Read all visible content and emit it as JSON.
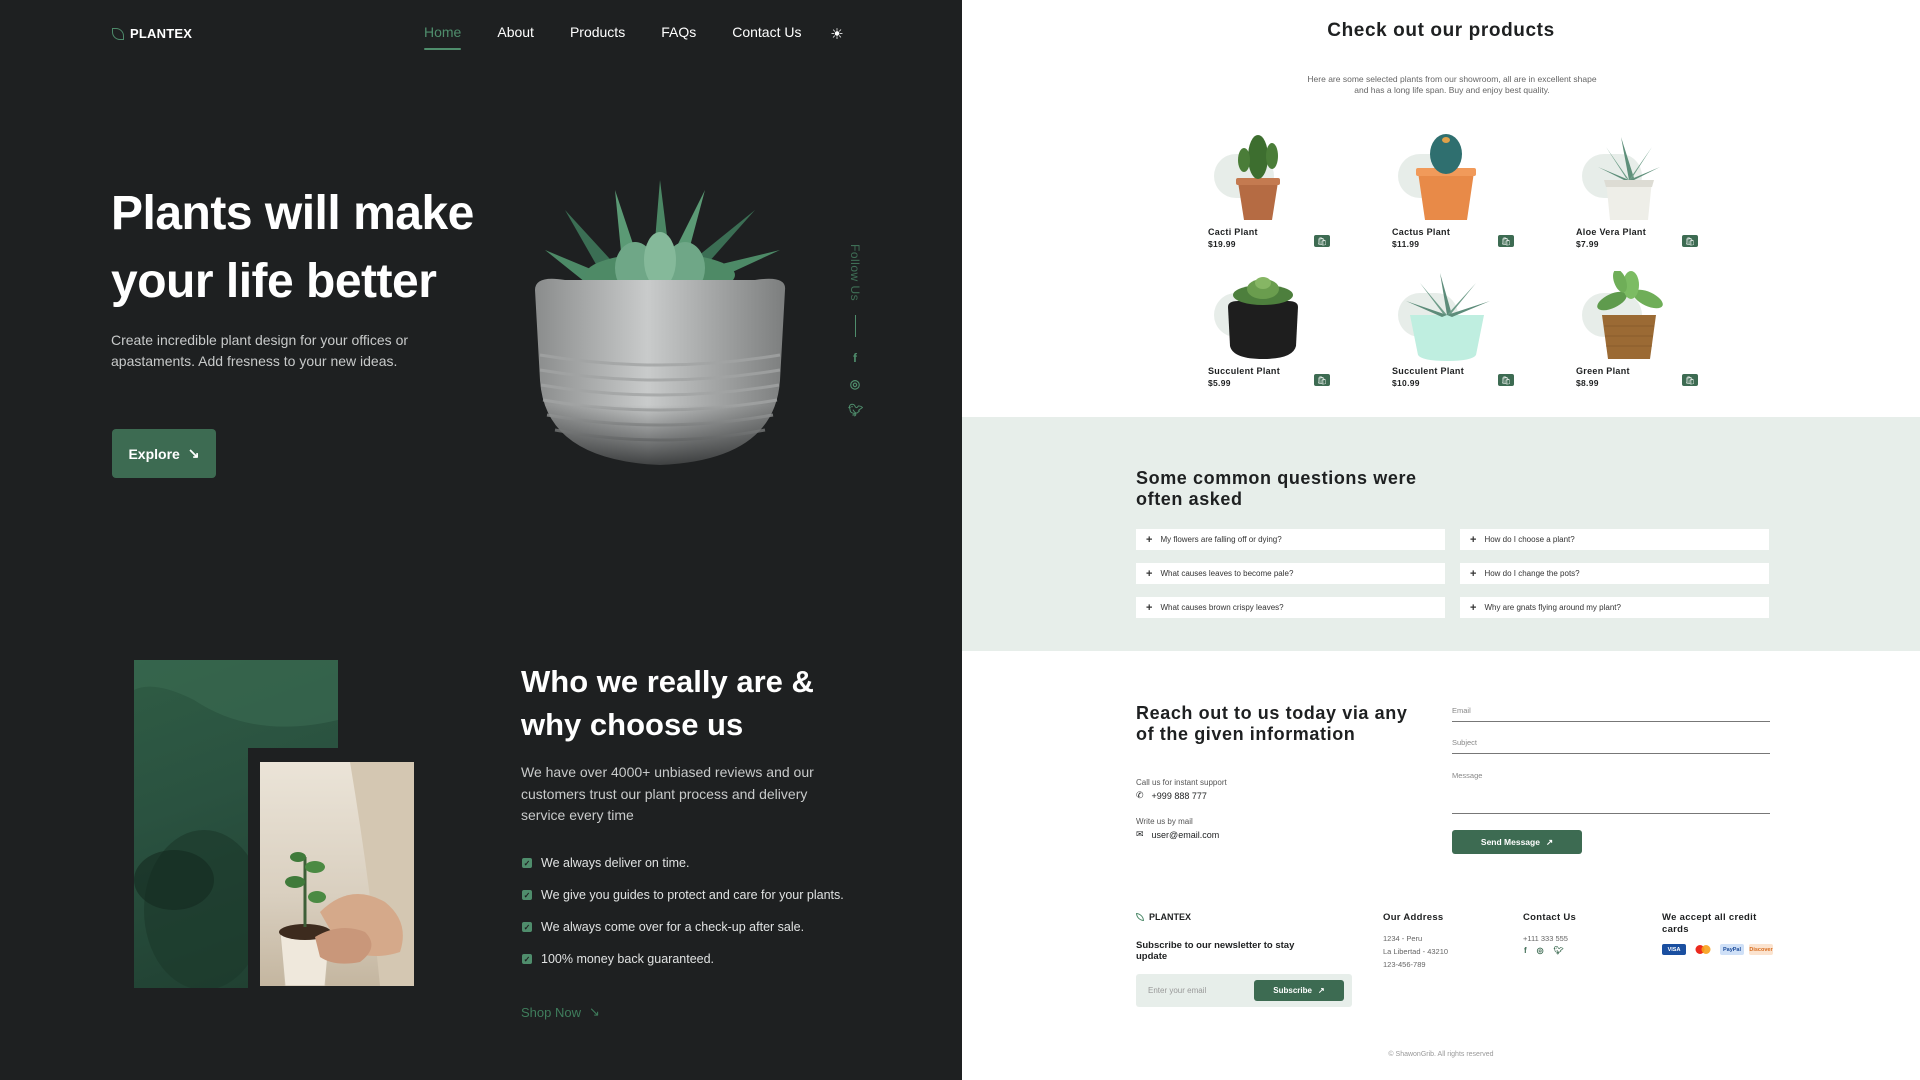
{
  "brand": {
    "name": "PLANTEX"
  },
  "nav": {
    "items": [
      "Home",
      "About",
      "Products",
      "FAQs",
      "Contact Us"
    ],
    "active": "Home"
  },
  "hero": {
    "title": "Plants will make your life better",
    "description": "Create incredible plant design for your offices or apastaments. Add fresness to your new ideas.",
    "button_label": "Explore"
  },
  "follow": {
    "label": "Follow Us",
    "socials": [
      "facebook-icon",
      "instagram-icon",
      "twitter-icon"
    ]
  },
  "about": {
    "title": "Who we really are & why choose us",
    "description": "We have over 4000+ unbiased reviews and our customers trust our plant process and delivery service every time",
    "checklist": [
      "We always deliver on time.",
      "We give you guides to protect and care for your plants.",
      "We always come over for a check-up after sale.",
      "100% money back guaranteed."
    ],
    "link_label": "Shop Now"
  },
  "products": {
    "title": "Check out our products",
    "description": "Here are some selected plants from our showroom, all are in excellent shape and has a long life span. Buy and enjoy best quality.",
    "items": [
      {
        "name": "Cacti Plant",
        "price": "$19.99"
      },
      {
        "name": "Cactus Plant",
        "price": "$11.99"
      },
      {
        "name": "Aloe Vera Plant",
        "price": "$7.99"
      },
      {
        "name": "Succulent Plant",
        "price": "$5.99"
      },
      {
        "name": "Succulent Plant",
        "price": "$10.99"
      },
      {
        "name": "Green Plant",
        "price": "$8.99"
      }
    ]
  },
  "faq": {
    "title": "Some common questions were often asked",
    "questions": [
      "My flowers are falling off or dying?",
      "How do I choose a plant?",
      "What causes leaves to become pale?",
      "How do I change the pots?",
      "What causes brown crispy leaves?",
      "Why are gnats flying around my plant?"
    ]
  },
  "contact": {
    "title": "Reach out to us today via any of the given information",
    "call_label": "Call us for instant support",
    "phone": "+999 888 777",
    "mail_label": "Write us by mail",
    "email": "user@email.com",
    "fields": {
      "email": "Email",
      "subject": "Subject",
      "message": "Message"
    },
    "send_label": "Send Message"
  },
  "footer": {
    "brand": "PLANTEX",
    "subscribe_title": "Subscribe to our newsletter to stay update",
    "newsletter_placeholder": "Enter your email",
    "subscribe_label": "Subscribe",
    "address_title": "Our Address",
    "address_lines": [
      "1234 - Peru",
      "La Libertad - 43210",
      "123-456-789"
    ],
    "contact_title": "Contact Us",
    "contact_phone": "+111 333 555",
    "cards_title": "We accept all credit cards",
    "cards": [
      "VISA",
      "MasterCard",
      "PayPal",
      "Discover"
    ],
    "copyright": "© ShawonGrib. All rights reserved"
  },
  "colors": {
    "dark_bg": "#1e2021",
    "accent": "#3d6b52",
    "accent_light": "#4f8d6c",
    "mint_bg": "#e7eeea"
  }
}
